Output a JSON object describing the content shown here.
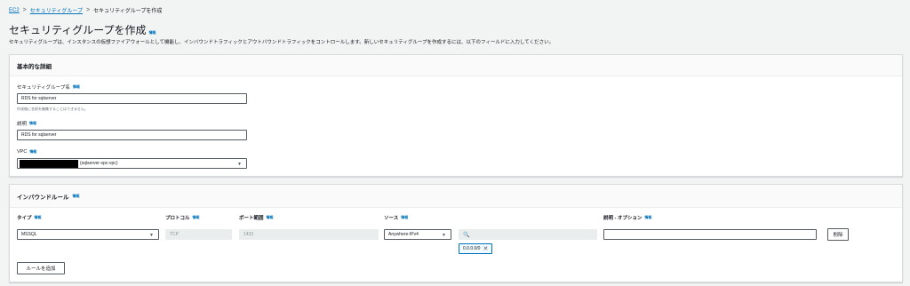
{
  "breadcrumb": {
    "items": [
      "EC2",
      "セキュリティグループ"
    ],
    "current": "セキュリティグループを作成",
    "separator": ">"
  },
  "page": {
    "title": "セキュリティグループを作成",
    "info": "情報",
    "description": "セキュリティグループは、インスタンスの仮想ファイアウォールとして機能し、インバウンドトラフィックとアウトバウンドトラフィックをコントロールします。新しいセキュリティグループを作成するには、以下のフィールドに入力してください。"
  },
  "basic": {
    "heading": "基本的な詳細",
    "name_label": "セキュリティグループ名",
    "name_value": "RDS for sqlserver",
    "name_hint": "作成後に名前を編集することはできません。",
    "desc_label": "説明",
    "desc_value": "RDS for sqlserver",
    "vpc_label": "VPC",
    "vpc_value": "(sqlserver-vpc-vpc)"
  },
  "inbound": {
    "heading": "インバウンドルール",
    "columns": {
      "type": "タイプ",
      "protocol": "プロトコル",
      "port": "ポート範囲",
      "source": "ソース",
      "desc": "説明 - オプション"
    },
    "row": {
      "type": "MSSQL",
      "protocol": "TCP",
      "port": "1433",
      "source": "Anywhere-IPv4",
      "search_icon": "🔍",
      "cidr": "0.0.0.0/0",
      "delete": "削除"
    },
    "add_rule": "ルールを追加"
  },
  "common": {
    "info": "情報",
    "dropdown": "▼",
    "remove": "✕"
  }
}
